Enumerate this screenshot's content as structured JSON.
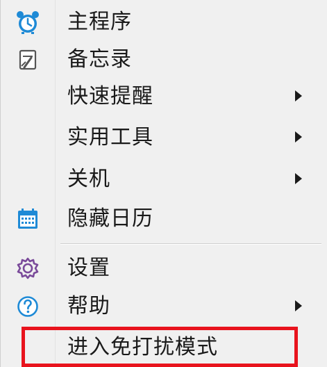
{
  "menu": {
    "items": [
      {
        "label": "主程序",
        "icon": "alarm-clock-icon",
        "submenu": false
      },
      {
        "label": "备忘录",
        "icon": "memo-icon",
        "submenu": false
      },
      {
        "label": "快速提醒",
        "icon": null,
        "submenu": true
      },
      {
        "label": "实用工具",
        "icon": null,
        "submenu": true
      },
      {
        "label": "关机",
        "icon": null,
        "submenu": true
      },
      {
        "label": "隐藏日历",
        "icon": "calendar-icon",
        "submenu": false
      },
      {
        "label": "设置",
        "icon": "gear-icon",
        "submenu": false
      },
      {
        "label": "帮助",
        "icon": "help-icon",
        "submenu": true
      },
      {
        "label": "进入免打扰模式",
        "icon": null,
        "submenu": false,
        "highlighted": true
      }
    ]
  },
  "colors": {
    "background": "#f0f0f0",
    "highlight_border": "#e8131d",
    "icon_blue": "#1e8ad6",
    "icon_purple": "#7a4a9a"
  }
}
